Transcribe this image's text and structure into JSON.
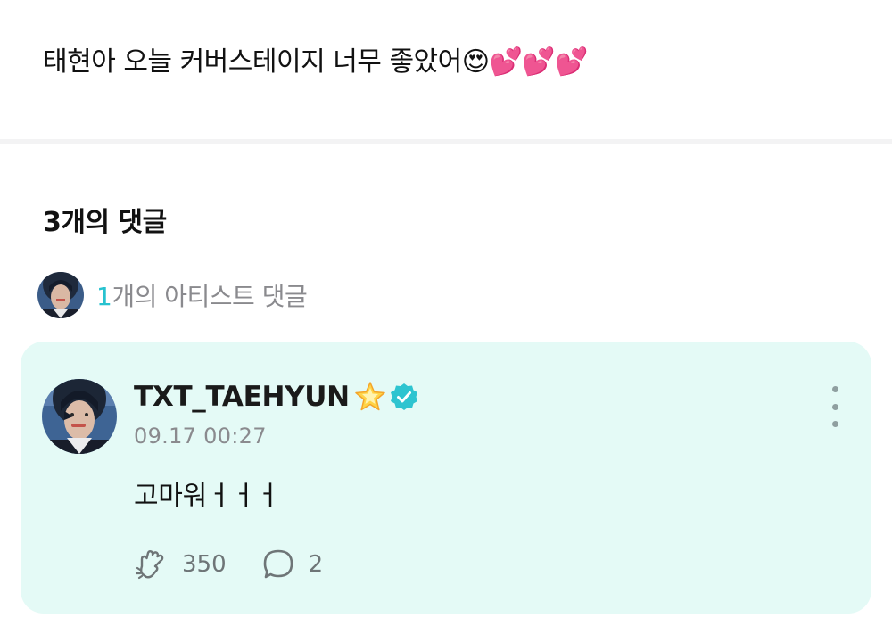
{
  "post": {
    "text": "태현아 오늘 커버스테이지 너무 좋았어😍💕💕💕"
  },
  "comments": {
    "header": "3개의 댓글",
    "artist_summary": {
      "count": "1",
      "label": "개의 아티스트 댓글"
    }
  },
  "artist_comment": {
    "author": "TXT_TAEHYUN",
    "timestamp": "09.17 00:27",
    "body": "고마워ㅓㅓㅓ",
    "like_count": "350",
    "reply_count": "2"
  },
  "colors": {
    "accent": "#27c2cf",
    "card_background": "#e4faf6",
    "verified": "#2ec4d0"
  },
  "icons": {
    "star": "star-icon",
    "verified": "verified-badge-icon",
    "more": "more-vertical-icon",
    "like": "cheer-hand-icon",
    "reply": "speech-bubble-icon"
  }
}
